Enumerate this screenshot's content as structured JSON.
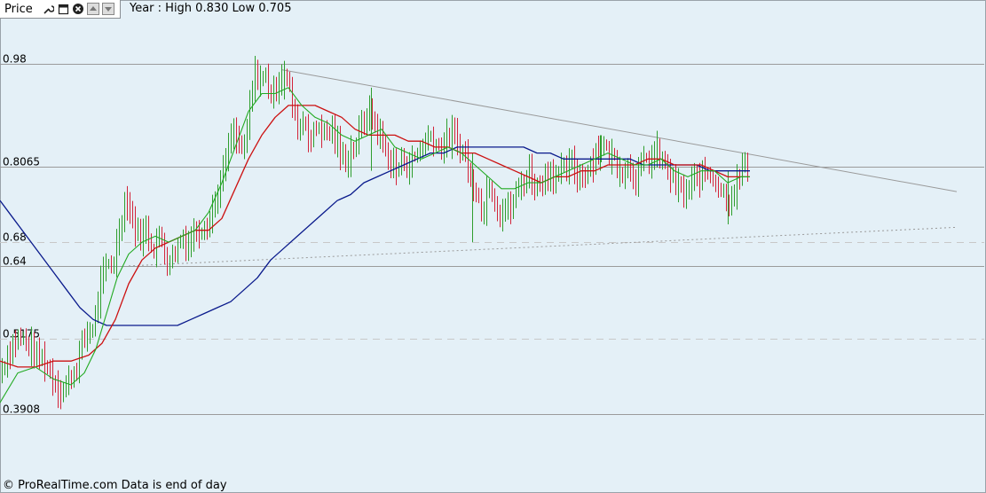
{
  "toolbar": {
    "title": "Price",
    "icons": [
      "wrench-icon",
      "window-icon",
      "close-icon",
      "arrow-up-icon",
      "arrow-down-icon"
    ]
  },
  "header": {
    "year_range": "Year : High 0.830 Low 0.705"
  },
  "footer": {
    "text": "© ProRealTime.com Data is end of day"
  },
  "chart_data": {
    "type": "line",
    "ylim": [
      0.35,
      1.05
    ],
    "y_ticks": [
      {
        "label": "0.98",
        "value": 0.98,
        "style": "solid"
      },
      {
        "label": "0.8065",
        "value": 0.8065,
        "style": "solid"
      },
      {
        "label": "0.68",
        "value": 0.68,
        "style": "dashed"
      },
      {
        "label": "0.64",
        "value": 0.64,
        "style": "solid"
      },
      {
        "label": "0.5175",
        "value": 0.5175,
        "style": "dashed"
      },
      {
        "label": "0.3908",
        "value": 0.3908,
        "style": "solid"
      }
    ],
    "colors": {
      "price": "#d2243a",
      "price_up": "#2e9e2e",
      "ma_short": "#22aa22",
      "ma_mid": "#cc1111",
      "ma_long": "#0a1a8c",
      "trend": "#999999"
    },
    "price_path": [
      [
        0,
        0.46
      ],
      [
        10,
        0.5
      ],
      [
        20,
        0.52
      ],
      [
        30,
        0.51
      ],
      [
        40,
        0.49
      ],
      [
        50,
        0.48
      ],
      [
        60,
        0.45
      ],
      [
        68,
        0.43
      ],
      [
        75,
        0.44
      ],
      [
        85,
        0.47
      ],
      [
        95,
        0.52
      ],
      [
        105,
        0.54
      ],
      [
        112,
        0.6
      ],
      [
        120,
        0.64
      ],
      [
        128,
        0.65
      ],
      [
        136,
        0.72
      ],
      [
        142,
        0.76
      ],
      [
        150,
        0.71
      ],
      [
        158,
        0.69
      ],
      [
        166,
        0.7
      ],
      [
        172,
        0.67
      ],
      [
        180,
        0.69
      ],
      [
        188,
        0.65
      ],
      [
        196,
        0.66
      ],
      [
        204,
        0.69
      ],
      [
        212,
        0.68
      ],
      [
        220,
        0.7
      ],
      [
        228,
        0.71
      ],
      [
        236,
        0.72
      ],
      [
        244,
        0.76
      ],
      [
        252,
        0.8
      ],
      [
        260,
        0.86
      ],
      [
        268,
        0.85
      ],
      [
        275,
        0.83
      ],
      [
        282,
        0.92
      ],
      [
        288,
        0.97
      ],
      [
        294,
        0.95
      ],
      [
        300,
        0.96
      ],
      [
        306,
        0.92
      ],
      [
        312,
        0.95
      ],
      [
        318,
        0.97
      ],
      [
        324,
        0.95
      ],
      [
        330,
        0.9
      ],
      [
        336,
        0.87
      ],
      [
        342,
        0.89
      ],
      [
        350,
        0.85
      ],
      [
        358,
        0.88
      ],
      [
        366,
        0.86
      ],
      [
        374,
        0.87
      ],
      [
        382,
        0.83
      ],
      [
        390,
        0.82
      ],
      [
        398,
        0.84
      ],
      [
        406,
        0.87
      ],
      [
        414,
        0.9
      ],
      [
        422,
        0.88
      ],
      [
        430,
        0.85
      ],
      [
        438,
        0.82
      ],
      [
        446,
        0.8
      ],
      [
        454,
        0.82
      ],
      [
        462,
        0.81
      ],
      [
        470,
        0.83
      ],
      [
        478,
        0.85
      ],
      [
        486,
        0.86
      ],
      [
        494,
        0.84
      ],
      [
        502,
        0.85
      ],
      [
        510,
        0.86
      ],
      [
        518,
        0.84
      ],
      [
        526,
        0.82
      ],
      [
        532,
        0.76
      ],
      [
        538,
        0.78
      ],
      [
        544,
        0.72
      ],
      [
        550,
        0.79
      ],
      [
        556,
        0.76
      ],
      [
        562,
        0.73
      ],
      [
        568,
        0.74
      ],
      [
        574,
        0.73
      ],
      [
        580,
        0.76
      ],
      [
        588,
        0.78
      ],
      [
        596,
        0.8
      ],
      [
        604,
        0.77
      ],
      [
        612,
        0.79
      ],
      [
        620,
        0.8
      ],
      [
        628,
        0.79
      ],
      [
        636,
        0.8
      ],
      [
        644,
        0.81
      ],
      [
        652,
        0.79
      ],
      [
        660,
        0.8
      ],
      [
        668,
        0.82
      ],
      [
        676,
        0.85
      ],
      [
        684,
        0.83
      ],
      [
        692,
        0.82
      ],
      [
        700,
        0.8
      ],
      [
        708,
        0.81
      ],
      [
        716,
        0.79
      ],
      [
        724,
        0.81
      ],
      [
        732,
        0.82
      ],
      [
        740,
        0.83
      ],
      [
        748,
        0.81
      ],
      [
        756,
        0.79
      ],
      [
        764,
        0.77
      ],
      [
        772,
        0.76
      ],
      [
        780,
        0.78
      ],
      [
        788,
        0.79
      ],
      [
        796,
        0.8
      ],
      [
        804,
        0.79
      ],
      [
        812,
        0.77
      ],
      [
        820,
        0.75
      ],
      [
        826,
        0.77
      ],
      [
        832,
        0.78
      ],
      [
        836,
        0.81
      ],
      [
        840,
        0.8
      ],
      [
        844,
        0.81
      ]
    ],
    "ma_short_path": [
      [
        0,
        0.41
      ],
      [
        20,
        0.46
      ],
      [
        40,
        0.47
      ],
      [
        60,
        0.45
      ],
      [
        80,
        0.44
      ],
      [
        95,
        0.46
      ],
      [
        108,
        0.5
      ],
      [
        120,
        0.56
      ],
      [
        132,
        0.62
      ],
      [
        145,
        0.66
      ],
      [
        160,
        0.68
      ],
      [
        175,
        0.69
      ],
      [
        190,
        0.68
      ],
      [
        205,
        0.69
      ],
      [
        220,
        0.7
      ],
      [
        235,
        0.73
      ],
      [
        250,
        0.78
      ],
      [
        265,
        0.84
      ],
      [
        280,
        0.9
      ],
      [
        295,
        0.93
      ],
      [
        310,
        0.93
      ],
      [
        325,
        0.94
      ],
      [
        340,
        0.91
      ],
      [
        355,
        0.89
      ],
      [
        370,
        0.88
      ],
      [
        385,
        0.86
      ],
      [
        400,
        0.85
      ],
      [
        415,
        0.86
      ],
      [
        430,
        0.87
      ],
      [
        445,
        0.84
      ],
      [
        460,
        0.83
      ],
      [
        475,
        0.82
      ],
      [
        490,
        0.83
      ],
      [
        505,
        0.84
      ],
      [
        520,
        0.83
      ],
      [
        535,
        0.81
      ],
      [
        550,
        0.79
      ],
      [
        565,
        0.77
      ],
      [
        580,
        0.77
      ],
      [
        595,
        0.78
      ],
      [
        610,
        0.78
      ],
      [
        625,
        0.79
      ],
      [
        640,
        0.8
      ],
      [
        655,
        0.81
      ],
      [
        670,
        0.82
      ],
      [
        685,
        0.83
      ],
      [
        700,
        0.82
      ],
      [
        715,
        0.81
      ],
      [
        730,
        0.81
      ],
      [
        745,
        0.82
      ],
      [
        760,
        0.8
      ],
      [
        775,
        0.79
      ],
      [
        790,
        0.8
      ],
      [
        805,
        0.8
      ],
      [
        820,
        0.78
      ],
      [
        835,
        0.79
      ],
      [
        845,
        0.79
      ]
    ],
    "ma_mid_path": [
      [
        0,
        0.48
      ],
      [
        20,
        0.47
      ],
      [
        40,
        0.47
      ],
      [
        60,
        0.48
      ],
      [
        80,
        0.48
      ],
      [
        100,
        0.49
      ],
      [
        115,
        0.51
      ],
      [
        130,
        0.55
      ],
      [
        145,
        0.61
      ],
      [
        160,
        0.65
      ],
      [
        175,
        0.67
      ],
      [
        190,
        0.68
      ],
      [
        205,
        0.69
      ],
      [
        220,
        0.7
      ],
      [
        235,
        0.7
      ],
      [
        250,
        0.72
      ],
      [
        265,
        0.77
      ],
      [
        280,
        0.82
      ],
      [
        295,
        0.86
      ],
      [
        310,
        0.89
      ],
      [
        325,
        0.91
      ],
      [
        340,
        0.91
      ],
      [
        355,
        0.91
      ],
      [
        370,
        0.9
      ],
      [
        385,
        0.89
      ],
      [
        400,
        0.87
      ],
      [
        415,
        0.86
      ],
      [
        430,
        0.86
      ],
      [
        445,
        0.86
      ],
      [
        460,
        0.85
      ],
      [
        475,
        0.85
      ],
      [
        490,
        0.84
      ],
      [
        505,
        0.84
      ],
      [
        520,
        0.83
      ],
      [
        535,
        0.83
      ],
      [
        550,
        0.82
      ],
      [
        565,
        0.81
      ],
      [
        580,
        0.8
      ],
      [
        595,
        0.79
      ],
      [
        610,
        0.78
      ],
      [
        625,
        0.79
      ],
      [
        640,
        0.79
      ],
      [
        655,
        0.8
      ],
      [
        670,
        0.8
      ],
      [
        685,
        0.81
      ],
      [
        700,
        0.81
      ],
      [
        715,
        0.81
      ],
      [
        730,
        0.82
      ],
      [
        745,
        0.82
      ],
      [
        760,
        0.81
      ],
      [
        775,
        0.81
      ],
      [
        790,
        0.81
      ],
      [
        805,
        0.8
      ],
      [
        820,
        0.79
      ],
      [
        835,
        0.79
      ],
      [
        845,
        0.79
      ]
    ],
    "ma_long_path": [
      [
        0,
        0.75
      ],
      [
        15,
        0.72
      ],
      [
        30,
        0.69
      ],
      [
        45,
        0.66
      ],
      [
        60,
        0.63
      ],
      [
        75,
        0.6
      ],
      [
        90,
        0.57
      ],
      [
        105,
        0.55
      ],
      [
        120,
        0.54
      ],
      [
        140,
        0.54
      ],
      [
        160,
        0.54
      ],
      [
        180,
        0.54
      ],
      [
        200,
        0.54
      ],
      [
        215,
        0.55
      ],
      [
        230,
        0.56
      ],
      [
        245,
        0.57
      ],
      [
        260,
        0.58
      ],
      [
        275,
        0.6
      ],
      [
        290,
        0.62
      ],
      [
        305,
        0.65
      ],
      [
        320,
        0.67
      ],
      [
        335,
        0.69
      ],
      [
        350,
        0.71
      ],
      [
        365,
        0.73
      ],
      [
        380,
        0.75
      ],
      [
        395,
        0.76
      ],
      [
        410,
        0.78
      ],
      [
        425,
        0.79
      ],
      [
        440,
        0.8
      ],
      [
        455,
        0.81
      ],
      [
        470,
        0.82
      ],
      [
        485,
        0.83
      ],
      [
        500,
        0.83
      ],
      [
        515,
        0.84
      ],
      [
        530,
        0.84
      ],
      [
        545,
        0.84
      ],
      [
        560,
        0.84
      ],
      [
        575,
        0.84
      ],
      [
        590,
        0.84
      ],
      [
        605,
        0.83
      ],
      [
        620,
        0.83
      ],
      [
        635,
        0.82
      ],
      [
        650,
        0.82
      ],
      [
        665,
        0.82
      ],
      [
        680,
        0.82
      ],
      [
        695,
        0.82
      ],
      [
        710,
        0.82
      ],
      [
        725,
        0.81
      ],
      [
        740,
        0.81
      ],
      [
        755,
        0.81
      ],
      [
        770,
        0.81
      ],
      [
        785,
        0.81
      ],
      [
        800,
        0.8
      ],
      [
        815,
        0.8
      ],
      [
        830,
        0.8
      ],
      [
        845,
        0.8
      ]
    ],
    "trend_upper": [
      [
        318,
        0.97
      ],
      [
        1078,
        0.765
      ]
    ],
    "trend_lower": [
      [
        145,
        0.64
      ],
      [
        1078,
        0.705
      ]
    ],
    "price_high_low": [
      [
        320,
        0.985,
        0.92
      ],
      [
        418,
        0.94,
        0.8
      ],
      [
        532,
        0.83,
        0.68
      ],
      [
        676,
        0.86,
        0.8
      ],
      [
        820,
        0.8,
        0.71
      ],
      [
        836,
        0.83,
        0.8
      ]
    ]
  }
}
